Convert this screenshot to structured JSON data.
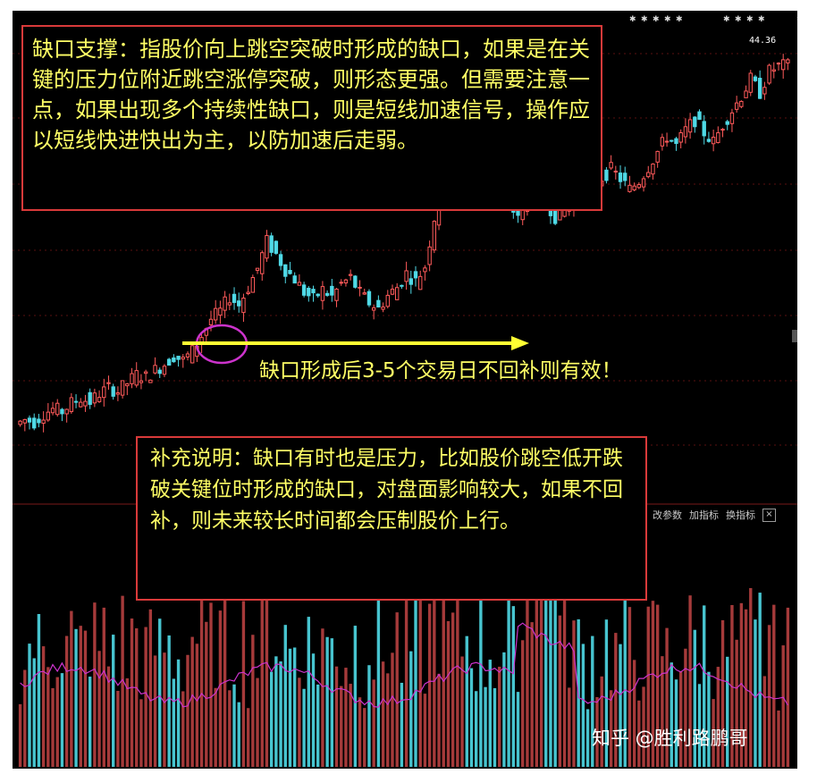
{
  "annotations": {
    "support_title_note": "缺口支撑：指股价向上跳空突破时形成的缺口，如果是在关键的压力位附近跳空涨停突破，则形态更强。但需要注意一点，如果出现多个持续性缺口，则是短线加速信号，操作应以短线快进快出为主，以防加速后走弱。",
    "gap_valid_note": "缺口形成后3-5个交易日不回补则有效！",
    "supplement_note": "补充说明：缺口有时也是压力，比如股价跳空低开跌破关键位时形成的缺口，对盘面影响较大，如果不回补，则未来较长时间都会压制股价上行。"
  },
  "price_label": "44.36",
  "indicator_toolbar": {
    "change_params": "改参数",
    "add_indicator": "加指标",
    "switch_indicator": "换指标",
    "close": "×"
  },
  "watermark": "知乎 @胜利路鹏哥",
  "colors": {
    "background": "#000000",
    "up_candle": "#ff5a5a",
    "down_candle": "#4fd9e6",
    "note_border": "#d93a3a",
    "note_text": "#ffff66",
    "arrow": "#ffff33",
    "gap_circle": "#cc33cc",
    "volume_ma": "#cc33cc"
  },
  "chart_data": {
    "type": "candlestick",
    "title": "",
    "last_price": 44.36,
    "trend": "uptrend with upward price gap circled near the start of the advance",
    "close_series": [
      14.0,
      14.4,
      14.2,
      14.9,
      15.3,
      15.1,
      15.8,
      16.2,
      15.9,
      16.6,
      17.1,
      16.8,
      17.5,
      18.2,
      18.0,
      18.6,
      19.1,
      19.8,
      19.4,
      20.2,
      21.5,
      22.9,
      23.6,
      24.8,
      24.1,
      25.6,
      27.2,
      29.5,
      28.4,
      27.1,
      26.3,
      25.2,
      24.6,
      25.4,
      24.8,
      25.9,
      26.4,
      25.1,
      24.3,
      23.8,
      24.9,
      25.6,
      26.8,
      26.1,
      27.4,
      31.5,
      33.8,
      35.2,
      37.6,
      36.2,
      34.1,
      32.9,
      33.6,
      32.4,
      31.8,
      32.7,
      33.5,
      32.9,
      31.6,
      32.4,
      33.2,
      34.5,
      33.8,
      34.9,
      35.6,
      34.8,
      33.9,
      34.6,
      35.8,
      37.1,
      38.4,
      37.6,
      38.9,
      39.8,
      38.7,
      37.9,
      39.4,
      40.6,
      41.8,
      43.2,
      42.1,
      43.9,
      44.36
    ]
  }
}
